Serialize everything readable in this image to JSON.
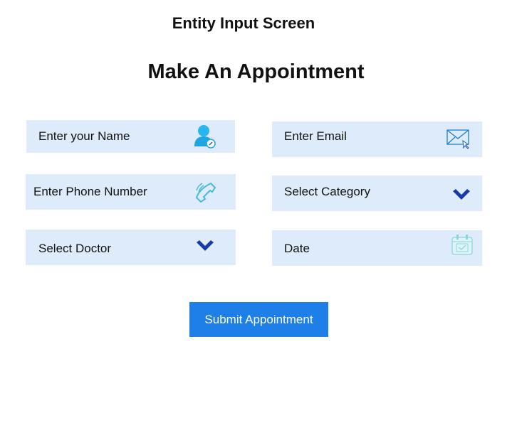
{
  "header": {
    "screen_title": "Entity Input Screen",
    "form_title": "Make An Appointment"
  },
  "fields": {
    "name": {
      "placeholder": "Enter your Name",
      "icon": "user-icon"
    },
    "email": {
      "placeholder": "Enter Email",
      "icon": "email-icon"
    },
    "phone": {
      "placeholder": "Enter Phone Number",
      "icon": "phone-icon"
    },
    "category": {
      "placeholder": "Select Category",
      "icon": "chevron-down-icon"
    },
    "doctor": {
      "placeholder": "Select Doctor",
      "icon": "chevron-down-icon"
    },
    "date": {
      "placeholder": "Date",
      "icon": "calendar-icon"
    }
  },
  "submit_label": "Submit Appointment",
  "colors": {
    "field_bg": "#deebfb",
    "accent": "#1e7fe8",
    "chevron": "#1a3aa8"
  }
}
